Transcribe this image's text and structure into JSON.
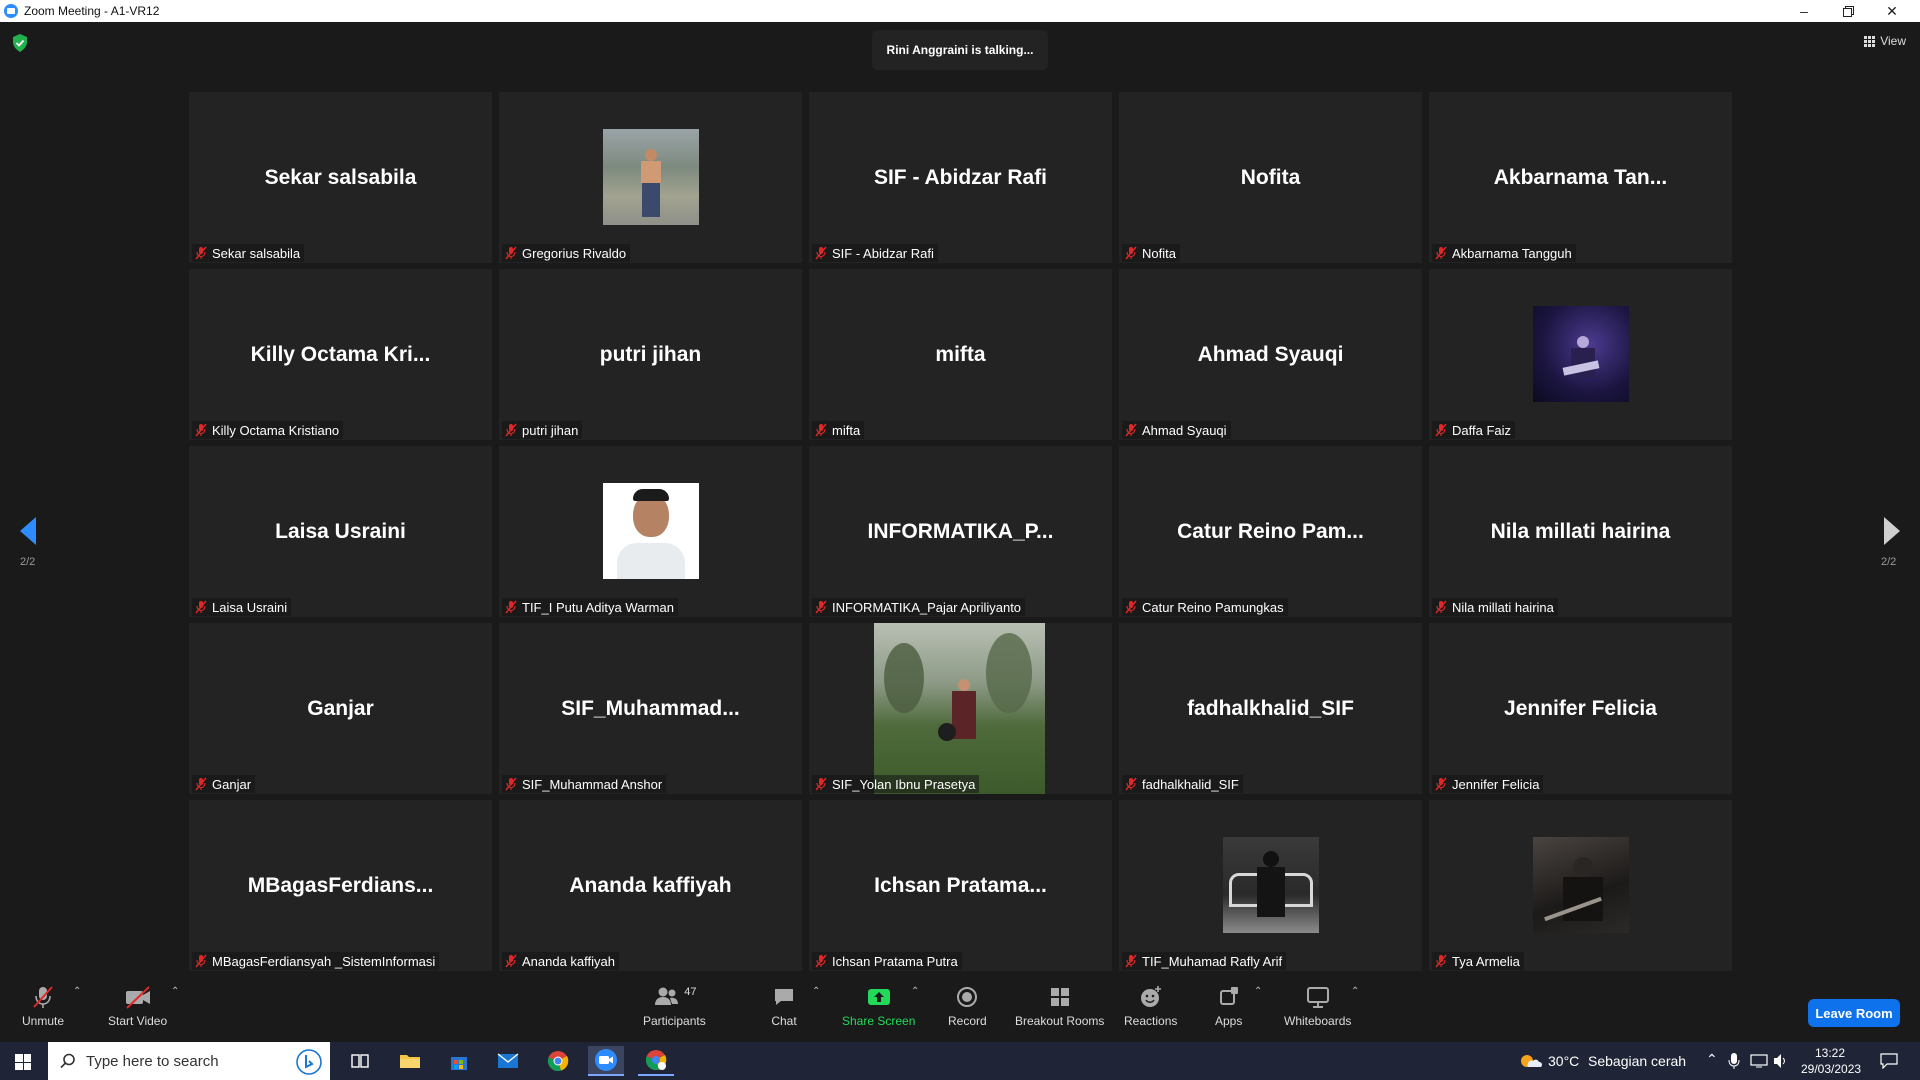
{
  "window": {
    "title": "Zoom Meeting - A1-VR12"
  },
  "meeting": {
    "talking_banner": "Rini Anggraini is talking...",
    "view_label": "View",
    "page_indicator_left": "2/2",
    "page_indicator_right": "2/2"
  },
  "tiles": [
    {
      "big": "Sekar salsabila",
      "label": "Sekar salsabila"
    },
    {
      "big": "",
      "label": "Gregorius Rivaldo",
      "photo": "outdoor"
    },
    {
      "big": "SIF - Abidzar Rafi",
      "label": "SIF - Abidzar Rafi"
    },
    {
      "big": "Nofita",
      "label": "Nofita"
    },
    {
      "big": "Akbarnama  Tan...",
      "label": "Akbarnama Tangguh"
    },
    {
      "big": "Killy  Octama  Kri...",
      "label": "Killy Octama Kristiano"
    },
    {
      "big": "putri jihan",
      "label": "putri jihan"
    },
    {
      "big": "mifta",
      "label": "mifta"
    },
    {
      "big": "Ahmad Syauqi",
      "label": "Ahmad Syauqi"
    },
    {
      "big": "",
      "label": "Daffa Faiz",
      "photo": "concert"
    },
    {
      "big": "Laisa Usraini",
      "label": "Laisa Usraini"
    },
    {
      "big": "",
      "label": "TIF_I Putu Aditya Warman",
      "photo": "portrait"
    },
    {
      "big": "INFORMATIKA_P...",
      "label": "INFORMATIKA_Pajar Apriliyanto"
    },
    {
      "big": "Catur  Reino  Pam...",
      "label": "Catur Reino Pamungkas"
    },
    {
      "big": "Nila millati hairina",
      "label": "Nila millati hairina"
    },
    {
      "big": "Ganjar",
      "label": "Ganjar"
    },
    {
      "big": "SIF_Muhammad...",
      "label": "SIF_Muhammad Anshor"
    },
    {
      "big": "",
      "label": "SIF_Yolan Ibnu Prasetya",
      "photo": "garden"
    },
    {
      "big": "fadhalkhalid_SIF",
      "label": "fadhalkhalid_SIF"
    },
    {
      "big": "Jennifer Felicia",
      "label": "Jennifer Felicia"
    },
    {
      "big": "MBagasFerdians...",
      "label": "MBagasFerdiansyah _SistemInformasi"
    },
    {
      "big": "Ananda kaffiyah",
      "label": "Ananda kaffiyah"
    },
    {
      "big": "Ichsan Pratama...",
      "label": "Ichsan Pratama Putra"
    },
    {
      "big": "",
      "label": "TIF_Muhamad Rafly Arif",
      "photo": "bench"
    },
    {
      "big": "",
      "label": "Tya Armelia",
      "photo": "dark"
    }
  ],
  "toolbar": {
    "unmute": "Unmute",
    "start_video": "Start Video",
    "participants": "Participants",
    "participants_count": "47",
    "chat": "Chat",
    "share_screen": "Share Screen",
    "record": "Record",
    "breakout_rooms": "Breakout Rooms",
    "reactions": "Reactions",
    "apps": "Apps",
    "whiteboards": "Whiteboards",
    "leave": "Leave Room"
  },
  "colors": {
    "accent": "#2d8cff",
    "share": "#23d959",
    "leave": "#0e72ed",
    "muted": "#e02828"
  },
  "taskbar": {
    "search_placeholder": "Type here to search",
    "weather_temp": "30°C",
    "weather_desc": "Sebagian cerah",
    "time": "13:22",
    "date": "29/03/2023"
  }
}
